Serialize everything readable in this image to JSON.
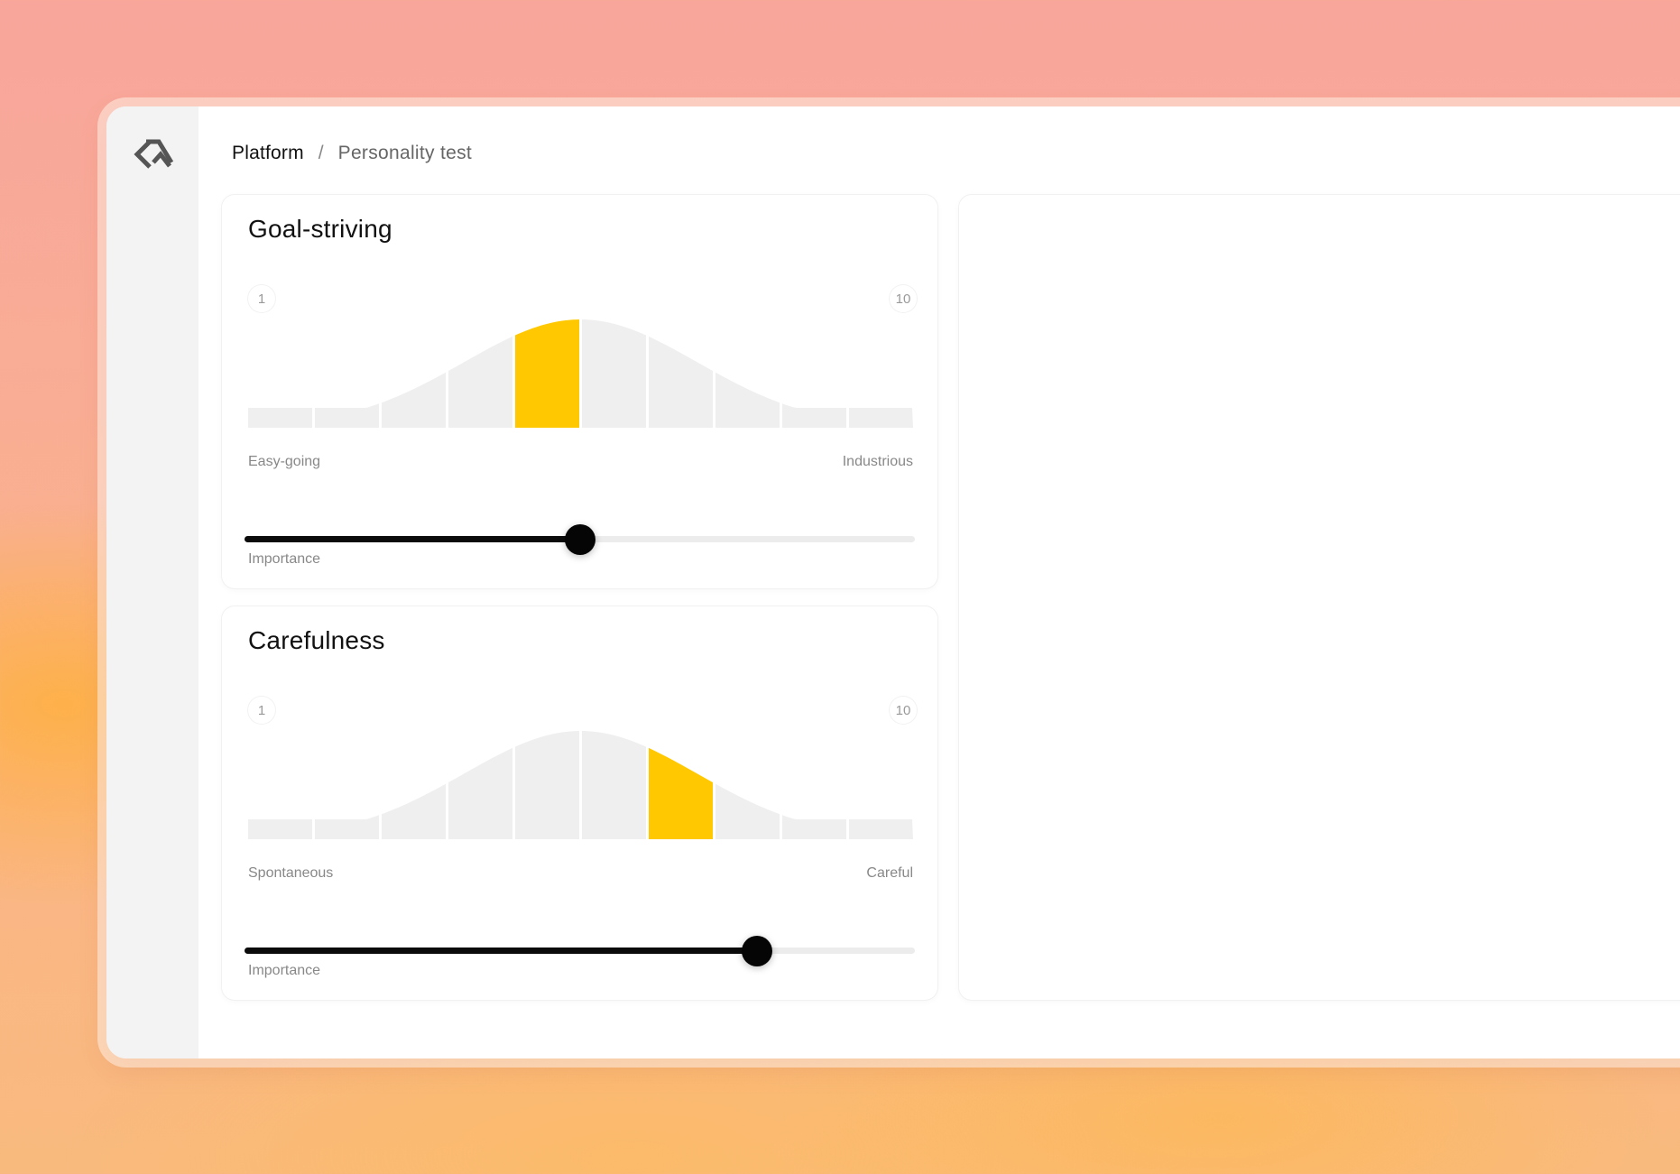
{
  "breadcrumb": {
    "root": "Platform",
    "separator": "/",
    "current": "Personality test"
  },
  "icons": {
    "logo": "diamond-logo-icon"
  },
  "colors": {
    "highlight": "#ffc800",
    "bar": "#efefef",
    "track": "#ececec",
    "fill": "#0b0b0b"
  },
  "traits": [
    {
      "title": "Goal-striving",
      "scale_min": "1",
      "scale_max": "10",
      "left_pole": "Easy-going",
      "right_pole": "Industrious",
      "selected_score": 5,
      "importance_label": "Importance",
      "importance": 0.5
    },
    {
      "title": "Carefulness",
      "scale_min": "1",
      "scale_max": "10",
      "left_pole": "Spontaneous",
      "right_pole": "Careful",
      "selected_score": 7,
      "importance_label": "Importance",
      "importance": 0.765
    }
  ]
}
